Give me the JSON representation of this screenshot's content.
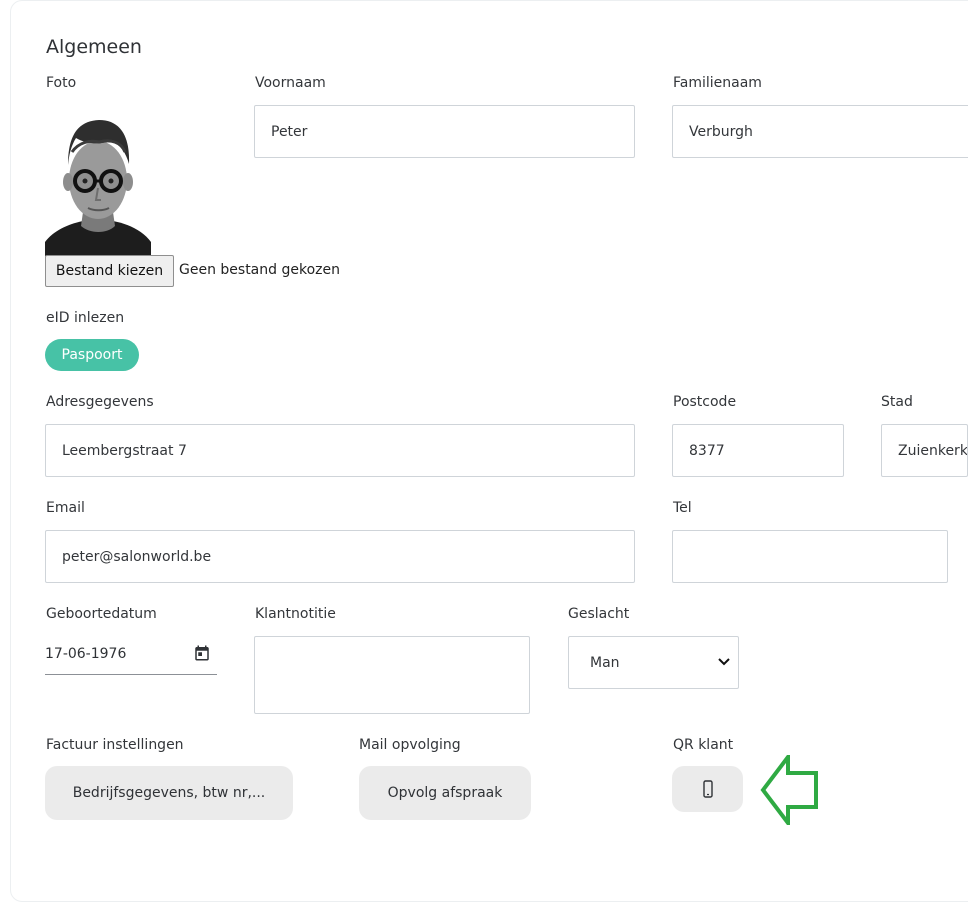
{
  "section": {
    "title": "Algemeen"
  },
  "photo": {
    "label": "Foto",
    "file_button_label": "Bestand kiezen",
    "file_status": "Geen bestand gekozen"
  },
  "eid": {
    "label": "eID inlezen",
    "button_label": "Paspoort",
    "button_color": "#47c2a6"
  },
  "fields": {
    "voornaam": {
      "label": "Voornaam",
      "value": "Peter"
    },
    "familienaam": {
      "label": "Familienaam",
      "value": "Verburgh"
    },
    "adres": {
      "label": "Adresgegevens",
      "value": "Leembergstraat 7"
    },
    "postcode": {
      "label": "Postcode",
      "value": "8377"
    },
    "stad": {
      "label": "Stad",
      "value": "Zuienkerk"
    },
    "email": {
      "label": "Email",
      "value": "peter@salonworld.be"
    },
    "tel": {
      "label": "Tel",
      "value": ""
    },
    "geboortedatum": {
      "label": "Geboortedatum",
      "value": "17-06-1976"
    },
    "klantnotitie": {
      "label": "Klantnotitie",
      "value": ""
    },
    "geslacht": {
      "label": "Geslacht",
      "value": "Man"
    }
  },
  "actions": {
    "factuur": {
      "label": "Factuur instellingen",
      "button_label": "Bedrijfsgegevens, btw nr,..."
    },
    "mail": {
      "label": "Mail opvolging",
      "button_label": "Opvolg afspraak"
    },
    "qr": {
      "label": "QR klant",
      "icon": "mobile-phone-icon"
    }
  },
  "annotation": {
    "arrow_color": "#2faa43"
  }
}
